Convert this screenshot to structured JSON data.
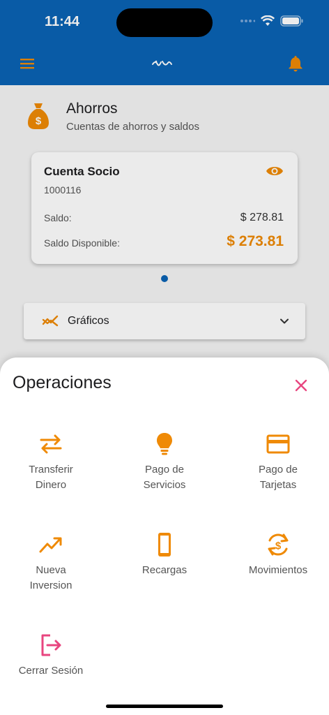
{
  "status_bar": {
    "time": "11:44"
  },
  "header": {
    "menu_icon": "menu-icon",
    "logo_icon": "brand-logo-icon",
    "bell_icon": "bell-icon"
  },
  "savings": {
    "title": "Ahorros",
    "subtitle": "Cuentas de ahorros y saldos",
    "icon": "money-bag-icon"
  },
  "account": {
    "name": "Cuenta Socio",
    "number": "1000116",
    "balance_label": "Saldo:",
    "balance_value": "$ 278.81",
    "available_label": "Saldo Disponible:",
    "available_value": "$ 273.81"
  },
  "charts": {
    "label": "Gráficos"
  },
  "sheet": {
    "title": "Operaciones",
    "operations": [
      {
        "label": "Transferir\nDinero",
        "icon": "transfer-icon"
      },
      {
        "label": "Pago de\nServicios",
        "icon": "lightbulb-icon"
      },
      {
        "label": "Pago de\nTarjetas",
        "icon": "credit-card-icon"
      },
      {
        "label": "Nueva\nInversion",
        "icon": "trending-up-icon"
      },
      {
        "label": "Recargas",
        "icon": "phone-icon"
      },
      {
        "label": "Movimientos",
        "icon": "currency-exchange-icon"
      },
      {
        "label": "Cerrar Sesión",
        "icon": "logout-icon"
      }
    ]
  },
  "colors": {
    "primary": "#0a63b5",
    "accent": "#ef8a06",
    "logout": "#e8457f",
    "close": "#e8457f"
  }
}
